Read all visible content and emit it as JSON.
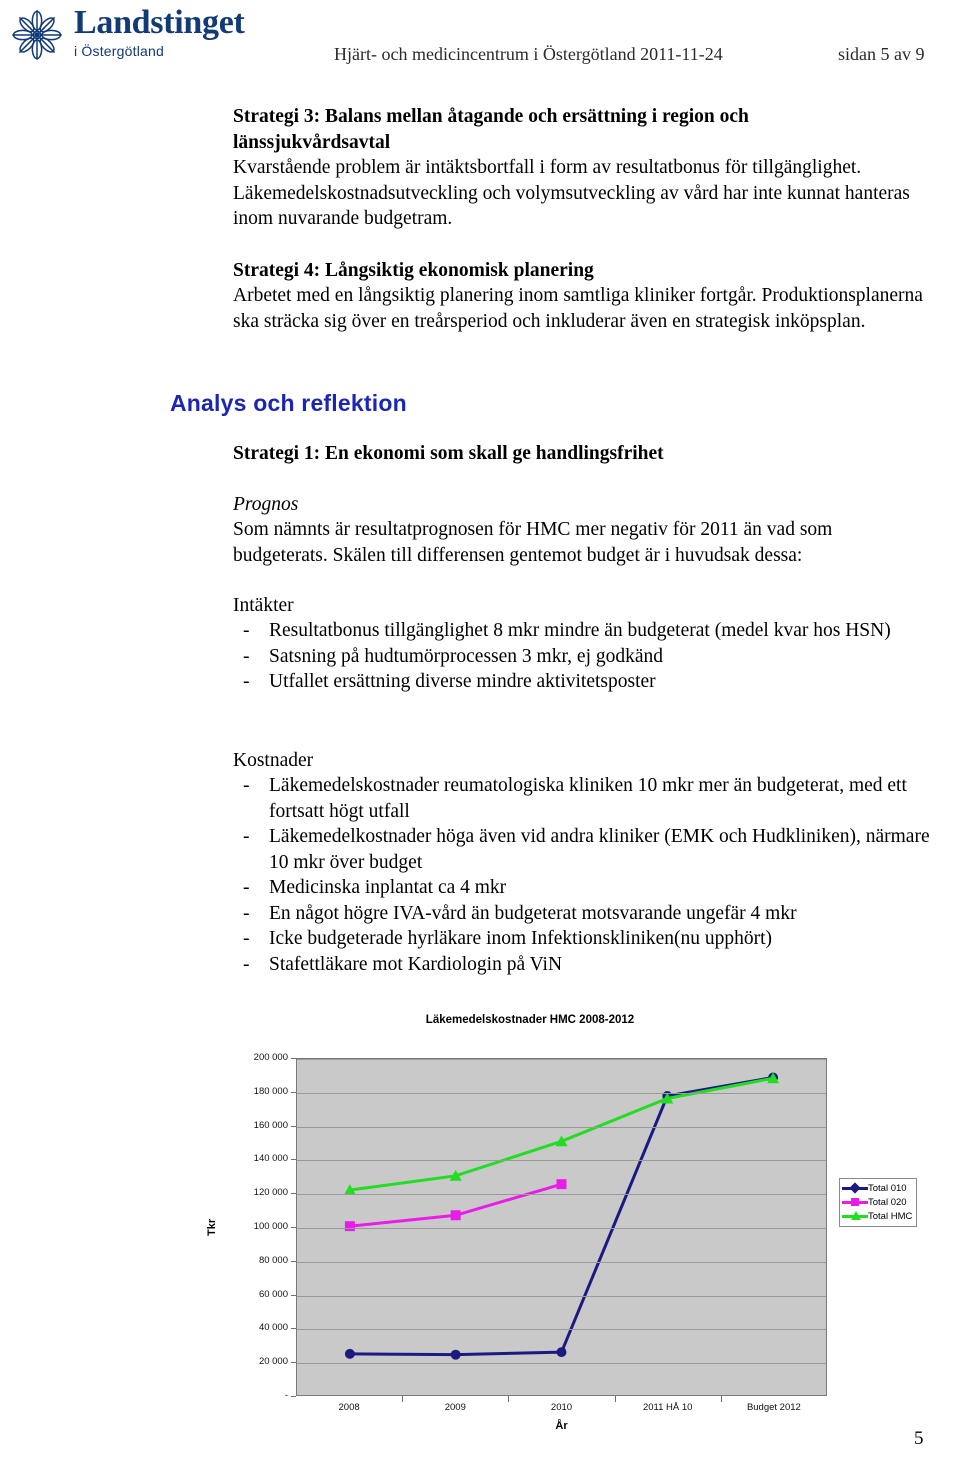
{
  "header": {
    "logo_title": "Landstinget",
    "logo_sub": "i Östergötland",
    "doc_title": "Hjärt- och medicincentrum i Östergötland 2011-11-24",
    "page_label": "sidan 5 av 9",
    "logo_color": "#123a75"
  },
  "body": {
    "strategi3": {
      "heading": "Strategi 3: Balans mellan åtagande och ersättning i region och länssjukvårdsavtal",
      "text": "Kvarstående problem är intäktsbortfall i form av resultatbonus för tillgänglighet. Läkemedelskostnadsutveckling och volymsutveckling av vård har inte kunnat hanteras inom nuvarande budgetram."
    },
    "strategi4": {
      "heading": "Strategi 4: Långsiktig ekonomisk planering",
      "text": "Arbetet med en långsiktig planering inom samtliga kliniker fortgår. Produktionsplanerna ska sträcka sig över en treårsperiod och inkluderar även en strategisk inköpsplan."
    },
    "section_heading": "Analys och reflektion",
    "section_heading_color": "#1c26b4",
    "strategi1": {
      "heading": "Strategi 1: En ekonomi som skall ge handlingsfrihet",
      "subheading": "Prognos",
      "text": "Som nämnts är resultatprognosen för HMC mer negativ för 2011 än vad som budgeterats. Skälen till differensen gentemot budget är i huvudsak dessa:"
    },
    "intakter": {
      "heading": "Intäkter",
      "bullet_marker": "-",
      "items": [
        "Resultatbonus tillgänglighet 8 mkr mindre än budgeterat (medel kvar hos HSN)",
        "Satsning på hudtumörprocessen 3 mkr, ej godkänd",
        "Utfallet ersättning diverse mindre aktivitetsposter"
      ]
    },
    "kostnader": {
      "heading": "Kostnader",
      "bullet_marker": "-",
      "items": [
        "Läkemedelskostnader reumatologiska kliniken 10 mkr mer än budgeterat, med ett fortsatt högt utfall",
        "Läkemedelkostnader höga även vid andra kliniker (EMK och Hudkliniken), närmare 10 mkr över budget",
        "Medicinska inplantat ca 4 mkr",
        "En något högre IVA-vård än budgeterat motsvarande ungefär 4 mkr",
        "Icke budgeterade hyrläkare inom Infektionskliniken(nu upphört)",
        "Stafettläkare mot Kardiologin på ViN"
      ]
    }
  },
  "footer": {
    "page_number": "5"
  },
  "chart_data": {
    "type": "line",
    "title": "Läkemedelskostnader HMC 2008-2012",
    "xlabel": "År",
    "ylabel": "Tkr",
    "categories": [
      "2008",
      "2009",
      "2010",
      "2011 HÅ 10",
      "Budget 2012"
    ],
    "ylim": [
      0,
      200000
    ],
    "yticks": [
      0,
      20000,
      40000,
      60000,
      80000,
      100000,
      120000,
      140000,
      160000,
      180000,
      200000
    ],
    "ytick_labels": [
      "-",
      "20 000",
      "40 000",
      "60 000",
      "80 000",
      "100 000",
      "120 000",
      "140 000",
      "160 000",
      "180 000",
      "200 000"
    ],
    "grid": true,
    "legend_position": "right",
    "plot_bg": "#c9c9c9",
    "series": [
      {
        "name": "Total 010",
        "color": "#1a1a80",
        "marker": "diamond",
        "values": [
          24500,
          24000,
          25500,
          178000,
          189000
        ]
      },
      {
        "name": "Total 020",
        "color": "#e81ee8",
        "marker": "square",
        "values": [
          100500,
          107000,
          125500,
          null,
          null
        ]
      },
      {
        "name": "Total HMC",
        "color": "#22dd22",
        "marker": "triangle",
        "values": [
          122000,
          130500,
          151000,
          176500,
          188500
        ]
      }
    ]
  }
}
